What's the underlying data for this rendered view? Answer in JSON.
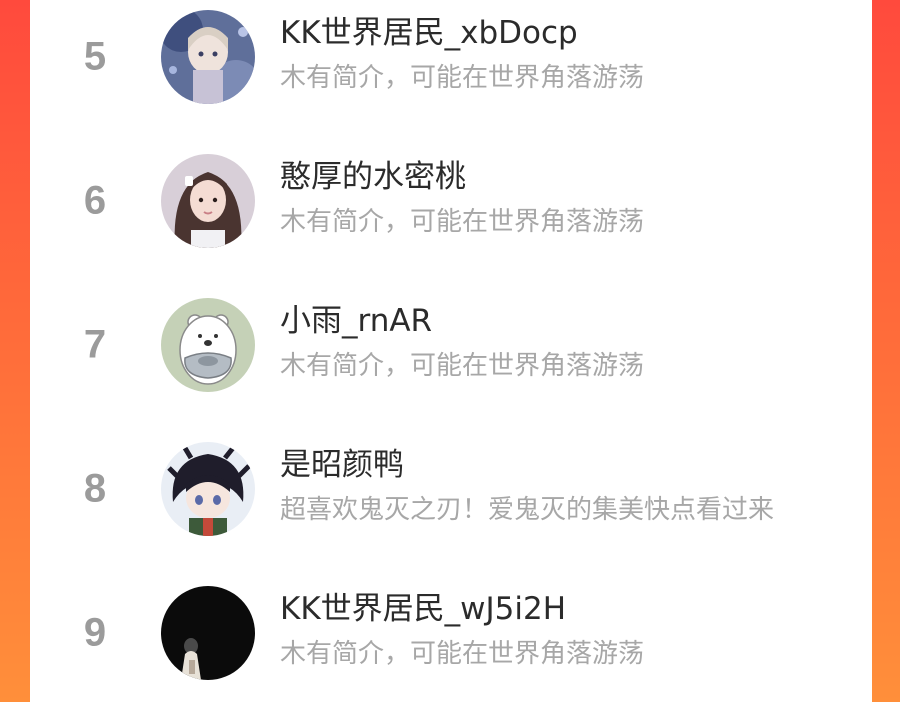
{
  "users": [
    {
      "rank": "5",
      "name": "KK世界居民_xbDocp",
      "bio": "木有简介，可能在世界角落游荡",
      "avatar_icon": "anime-girl-avatar"
    },
    {
      "rank": "6",
      "name": "憨厚的水密桃",
      "bio": "木有简介，可能在世界角落游荡",
      "avatar_icon": "girl-photo-avatar"
    },
    {
      "rank": "7",
      "name": "小雨_rnAR",
      "bio": "木有简介，可能在世界角落游荡",
      "avatar_icon": "polar-bear-avatar"
    },
    {
      "rank": "8",
      "name": "是昭颜鸭",
      "bio": "超喜欢鬼灭之刃！爱鬼灭的集美快点看过来",
      "avatar_icon": "anime-boy-avatar"
    },
    {
      "rank": "9",
      "name": "KK世界居民_wJ5i2H",
      "bio": "木有简介，可能在世界角落游荡",
      "avatar_icon": "dark-photo-avatar"
    }
  ]
}
